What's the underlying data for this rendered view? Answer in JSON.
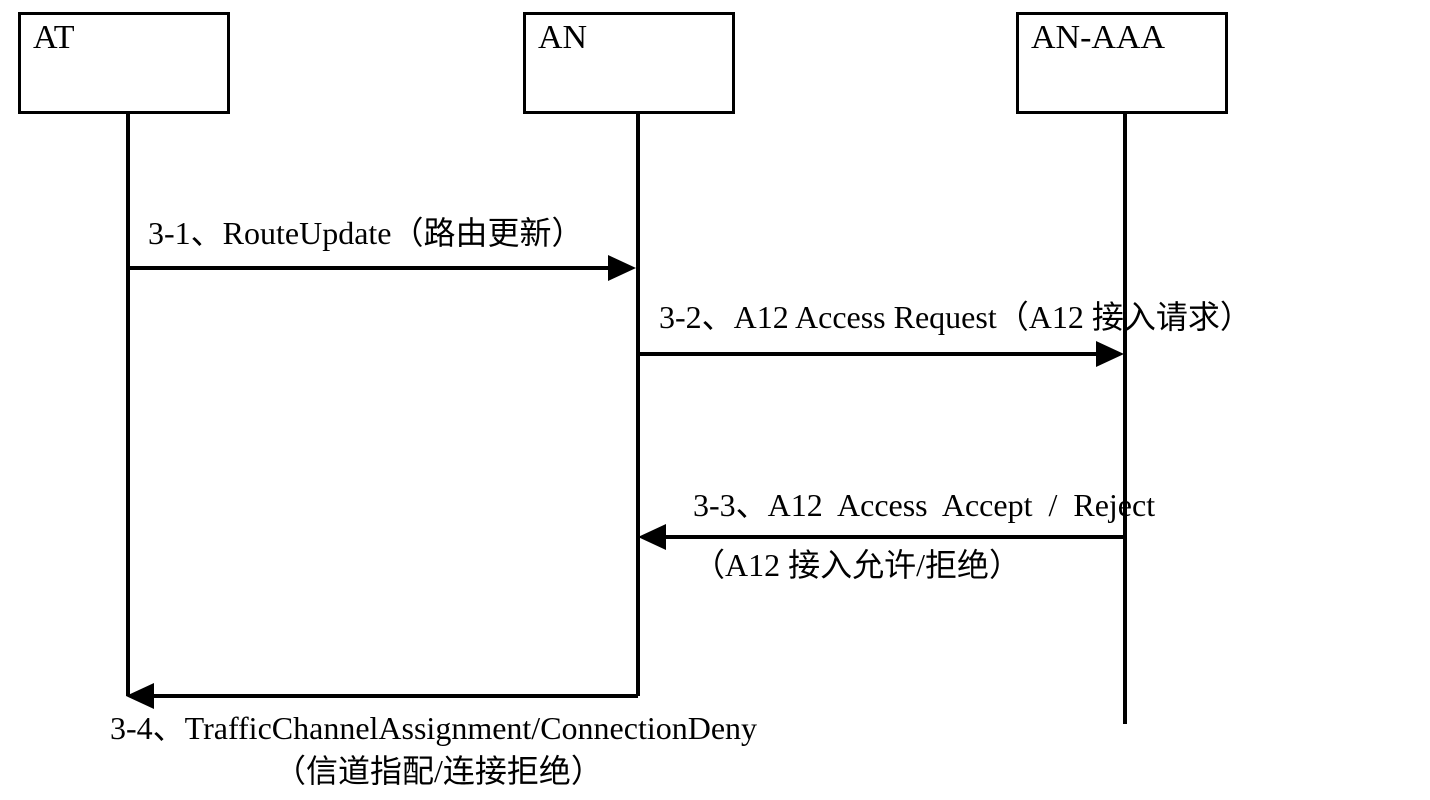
{
  "participants": {
    "at": "AT",
    "an": "AN",
    "an_aaa": "AN-AAA"
  },
  "messages": {
    "m1": "3-1、RouteUpdate（路由更新）",
    "m2": "3-2、A12 Access Request（A12 接入请求）",
    "m3a": "3-3、A12  Access  Accept  /  Reject",
    "m3b": "（A12 接入允许/拒绝）",
    "m4a": "3-4、TrafficChannelAssignment/ConnectionDeny",
    "m4b": "（信道指配/连接拒绝）"
  }
}
